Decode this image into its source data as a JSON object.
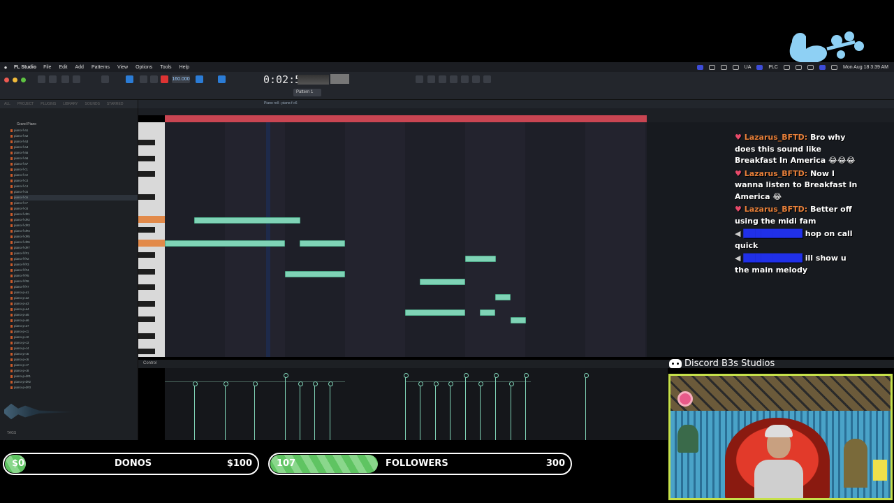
{
  "menubar": {
    "app_name": "FL Studio",
    "items": [
      "File",
      "Edit",
      "Add",
      "Patterns",
      "View",
      "Options",
      "Tools",
      "Help"
    ],
    "status": {
      "lang": "UA",
      "plc": "PLC",
      "datetime": "Mon Aug 18  3:39 AM"
    }
  },
  "toolbar": {
    "tempo": "160.000",
    "time": "0:02:57",
    "pattern": "Pattern 1"
  },
  "piano_roll": {
    "title": "Piano roll - piano-f-c6",
    "control_label": "Control"
  },
  "browser": {
    "tabs": [
      "ALL",
      "PROJECT",
      "PLUGINS",
      "LIBRARY",
      "SOUNDS",
      "STARRED"
    ],
    "folder": "Grand Piano",
    "items": [
      "piano-f-a1",
      "piano-f-a2",
      "piano-f-a3",
      "piano-f-a4",
      "piano-f-a5",
      "piano-f-a6",
      "piano-f-a7",
      "piano-f-c1",
      "piano-f-c2",
      "piano-f-c3",
      "piano-f-c4",
      "piano-f-c5",
      "piano-f-c6",
      "piano-f-c7",
      "piano-f-c8",
      "piano-f-d#1",
      "piano-f-d#2",
      "piano-f-d#3",
      "piano-f-d#4",
      "piano-f-d#5",
      "piano-f-d#6",
      "piano-f-d#7",
      "piano-f-f#1",
      "piano-f-f#2",
      "piano-f-f#3",
      "piano-f-f#4",
      "piano-f-f#5",
      "piano-f-f#6",
      "piano-f-f#7",
      "piano-p-a1",
      "piano-p-a2",
      "piano-p-a3",
      "piano-p-a4",
      "piano-p-a5",
      "piano-p-a6",
      "piano-p-a7",
      "piano-p-c1",
      "piano-p-c2",
      "piano-p-c3",
      "piano-p-c4",
      "piano-p-c5",
      "piano-p-c6",
      "piano-p-c7",
      "piano-p-c8",
      "piano-p-d#1",
      "piano-p-d#2",
      "piano-p-d#3"
    ],
    "selected_index": 12,
    "tags_label": "TAGS"
  },
  "chat": [
    {
      "icon": "heart",
      "user": "Lazarus_BFTD:",
      "text": "Bro why does this sound like Breakfast In America 😂😂😂"
    },
    {
      "icon": "heart",
      "user": "Lazarus_BFTD:",
      "text": "Now I wanna listen to Breakfast In America 😂"
    },
    {
      "icon": "heart",
      "user": "Lazarus_BFTD:",
      "text": "Better off using the midi fam"
    },
    {
      "icon": "speaker",
      "user": "",
      "text": "hop on call quick"
    },
    {
      "icon": "speaker",
      "user": "",
      "text": "ill show u the main melody"
    }
  ],
  "discord": {
    "label": "Discord B3s Studios"
  },
  "goals": {
    "donos": {
      "current": "$0",
      "label": "DONOS",
      "target": "$100",
      "progress": 0.0
    },
    "followers": {
      "current": "107",
      "label": "FOLLOWERS",
      "target": "300",
      "progress": 0.357
    }
  },
  "colors": {
    "accent_green": "#7fd3b6",
    "timeline_red": "#c94552",
    "goal_green": "#5fc462",
    "chat_user": "#e8803a"
  }
}
